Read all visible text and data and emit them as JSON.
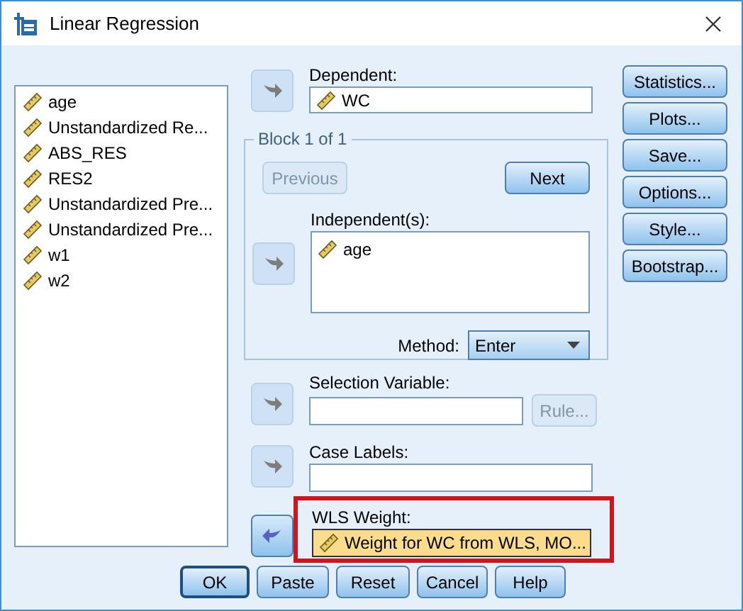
{
  "window": {
    "title": "Linear Regression"
  },
  "variables": [
    "age",
    "Unstandardized Re...",
    "ABS_RES",
    "RES2",
    "Unstandardized Pre...",
    "Unstandardized Pre...",
    "w1",
    "w2"
  ],
  "dependent": {
    "label": "Dependent:",
    "arrow": {
      "kind": "add",
      "active": false
    },
    "values": [
      "WC"
    ]
  },
  "block": {
    "title": "Block 1 of 1",
    "previous": {
      "label": "Previous",
      "disabled": true
    },
    "next": {
      "label": "Next",
      "disabled": false
    },
    "independent": {
      "label": "Independent(s):",
      "arrow": {
        "kind": "add",
        "active": false
      },
      "values": [
        "age"
      ]
    },
    "method": {
      "label": "Method:",
      "value": "Enter"
    }
  },
  "selection": {
    "label": "Selection Variable:",
    "arrow": {
      "kind": "add",
      "active": false
    },
    "rule": {
      "label": "Rule...",
      "disabled": true
    }
  },
  "case_labels": {
    "label": "Case Labels:",
    "arrow": {
      "kind": "add",
      "active": false
    }
  },
  "wls_weight": {
    "label": "WLS Weight:",
    "arrow": {
      "kind": "remove",
      "active": true
    },
    "value": "Weight for WC from WLS, MO...",
    "highlighted": true
  },
  "side_buttons": [
    {
      "label": "Statistics..."
    },
    {
      "label": "Plots..."
    },
    {
      "label": "Save..."
    },
    {
      "label": "Options..."
    },
    {
      "label": "Style..."
    },
    {
      "label": "Bootstrap..."
    }
  ],
  "buttons": [
    {
      "label": "OK",
      "default": true
    },
    {
      "label": "Paste",
      "default": false
    },
    {
      "label": "Reset",
      "default": false
    },
    {
      "label": "Cancel",
      "default": false
    },
    {
      "label": "Help",
      "default": false
    }
  ]
}
